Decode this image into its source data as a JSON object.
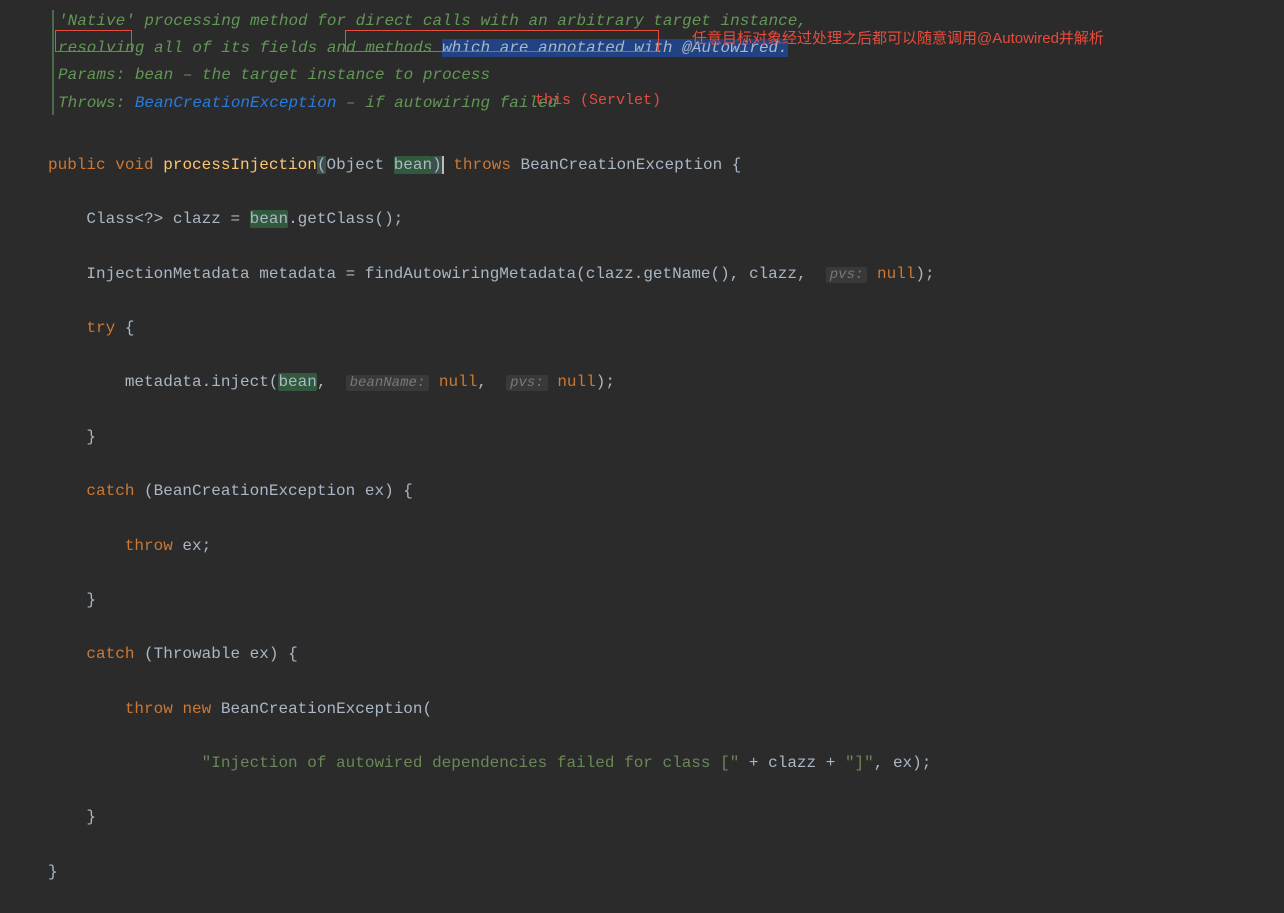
{
  "javadoc": {
    "line1_a": "'Native' processing method for direct calls with an arbitrary target instance,",
    "line2_a": "resolving",
    "line2_b": " all of ",
    "line2_c": "its fields and methods ",
    "line2_sel": "which are annotated with ",
    "line2_autowired": "@Autowired",
    "line2_dot": ".",
    "params_label": "Params: ",
    "params_var": "bean",
    "params_rest": " – the target instance to process",
    "throws_label": "Throws: ",
    "throws_link": "BeanCreationException",
    "throws_rest": " – if autowiring failed"
  },
  "annotations": {
    "chinese": "任意目标对象经过处理之后都可以随意调用@Autowired并解析",
    "this_label": "this",
    "servlet_label": "  (Servlet)"
  },
  "code": {
    "public": "public",
    "void": "void",
    "method": "processInjection",
    "object": "Object",
    "bean": "bean",
    "throws": "throws",
    "bce": "BeanCreationException",
    "class_wild": "Class<?>",
    "clazz": "clazz",
    "getClass": ".getClass();",
    "injMeta": "InjectionMetadata",
    "metadata": "metadata",
    "findAuto": "findAutowiringMetadata(clazz.getName(), clazz, ",
    "hint_pvs": "pvs:",
    "null": "null",
    "try": "try",
    "inject_call_a": "metadata.inject(",
    "hint_beanName": "beanName:",
    "catch": "catch",
    "throwable": "Throwable",
    "ex": "ex",
    "throw": "throw",
    "new": "new",
    "str_a": "\"Injection of autowired dependencies failed for class [\"",
    "str_b": "\"]\""
  }
}
